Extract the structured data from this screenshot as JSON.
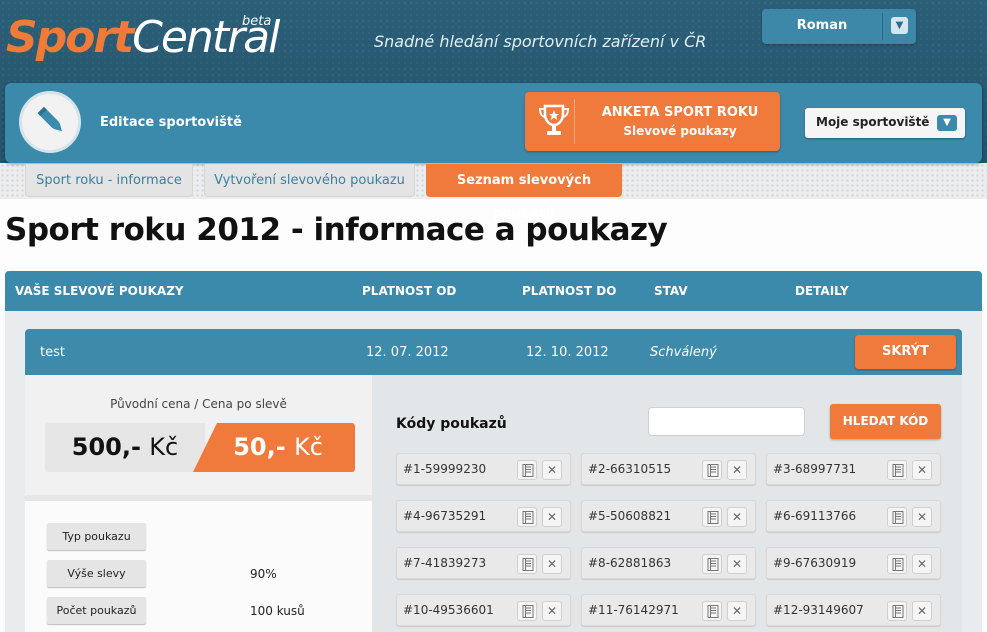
{
  "header": {
    "logo_sport": "Sport",
    "logo_central": "Central",
    "logo_beta": "beta",
    "tagline": "Snadné hledání sportovních zařízení v ČR",
    "user_name": "Roman"
  },
  "toolbar": {
    "title": "Editace sportoviště",
    "anketa_line1": "ANKETA SPORT ROKU",
    "anketa_line2": "Slevové poukazy",
    "moje_label": "Moje sportoviště"
  },
  "tabs": [
    {
      "label": "Sport roku - informace",
      "active": false
    },
    {
      "label": "Vytvoření slevového poukazu",
      "active": false
    },
    {
      "label": "Seznam slevových poukazů",
      "active": true
    }
  ],
  "page_title": "Sport roku 2012 - informace a poukazy",
  "list_header": {
    "col_name": "VAŠE SLEVOVÉ POUKAZY",
    "col_from": "PLATNOST OD",
    "col_to": "PLATNOST DO",
    "col_state": "STAV",
    "col_detail": "DETAILY"
  },
  "coupon": {
    "name": "test",
    "valid_from": "12. 07. 2012",
    "valid_to": "12. 10. 2012",
    "state": "Schválený",
    "hide_label": "SKRÝT",
    "price_label": "Původní cena / Cena po slevě",
    "price_old": "500,-",
    "price_new": "50,-",
    "currency": "Kč",
    "info": [
      {
        "label": "Typ poukazu",
        "value": ""
      },
      {
        "label": "Výše slevy",
        "value": "90%"
      },
      {
        "label": "Počet poukazů",
        "value": "100 kusů"
      }
    ]
  },
  "codes_panel": {
    "title": "Kódy poukazů",
    "search_placeholder": "",
    "search_value": "",
    "search_button": "HLEDAT KÓD",
    "codes": [
      "#1-59999230",
      "#2-66310515",
      "#3-68997731",
      "#4-96735291",
      "#5-50608821",
      "#6-69113766",
      "#7-41839273",
      "#8-62881863",
      "#9-67630919",
      "#10-49536601",
      "#11-76142971",
      "#12-93149607"
    ]
  },
  "colors": {
    "brand_blue": "#3b89ab",
    "brand_orange": "#f07a3c",
    "header_dark": "#2b5f78"
  }
}
